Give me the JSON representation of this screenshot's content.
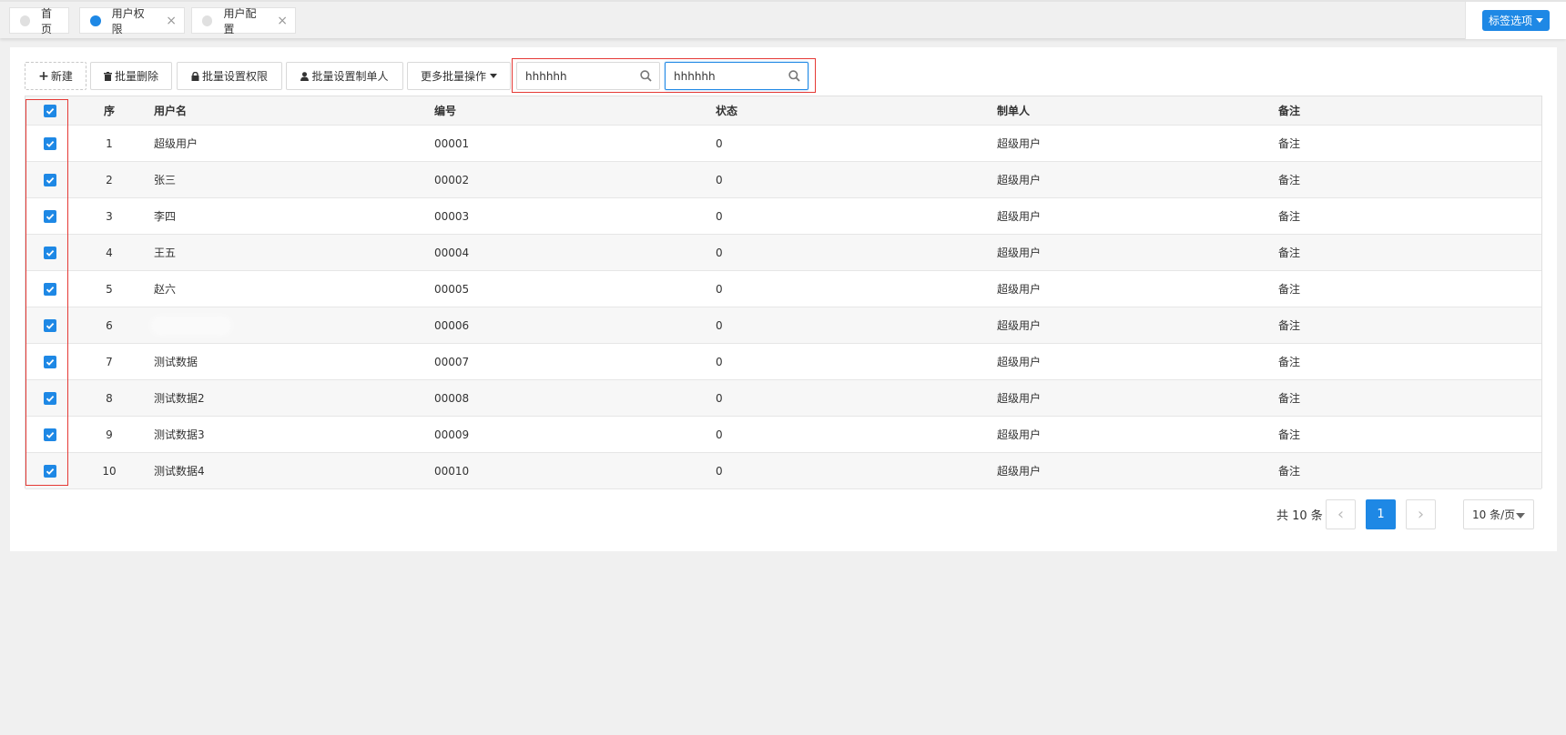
{
  "tabs": [
    {
      "label": "首页",
      "active": false,
      "closable": false
    },
    {
      "label": "用户权限",
      "active": true,
      "closable": true
    },
    {
      "label": "用户配置",
      "active": false,
      "closable": true
    }
  ],
  "tab_close_glyph": "×",
  "tag_options_label": "标签选项",
  "toolbar": {
    "new_label": "新建",
    "batch_delete_label": "批量删除",
    "batch_permission_label": "批量设置权限",
    "batch_creator_label": "批量设置制单人",
    "more_batch_label": "更多批量操作"
  },
  "search": {
    "first_value": "hhhhhh",
    "second_value": "hhhhhh"
  },
  "table": {
    "columns": [
      "序",
      "用户名",
      "编号",
      "状态",
      "制单人",
      "备注"
    ],
    "all_selected": true,
    "rows": [
      {
        "index": "1",
        "username": "超级用户",
        "code": "00001",
        "status": "0",
        "creator": "超级用户",
        "remark": "备注",
        "selected": true
      },
      {
        "index": "2",
        "username": "张三",
        "code": "00002",
        "status": "0",
        "creator": "超级用户",
        "remark": "备注",
        "selected": true
      },
      {
        "index": "3",
        "username": "李四",
        "code": "00003",
        "status": "0",
        "creator": "超级用户",
        "remark": "备注",
        "selected": true
      },
      {
        "index": "4",
        "username": "王五",
        "code": "00004",
        "status": "0",
        "creator": "超级用户",
        "remark": "备注",
        "selected": true
      },
      {
        "index": "5",
        "username": "赵六",
        "code": "00005",
        "status": "0",
        "creator": "超级用户",
        "remark": "备注",
        "selected": true
      },
      {
        "index": "6",
        "username": "",
        "code": "00006",
        "status": "0",
        "creator": "超级用户",
        "remark": "备注",
        "selected": true
      },
      {
        "index": "7",
        "username": "测试数据",
        "code": "00007",
        "status": "0",
        "creator": "超级用户",
        "remark": "备注",
        "selected": true
      },
      {
        "index": "8",
        "username": "测试数据2",
        "code": "00008",
        "status": "0",
        "creator": "超级用户",
        "remark": "备注",
        "selected": true
      },
      {
        "index": "9",
        "username": "测试数据3",
        "code": "00009",
        "status": "0",
        "creator": "超级用户",
        "remark": "备注",
        "selected": true
      },
      {
        "index": "10",
        "username": "测试数据4",
        "code": "00010",
        "status": "0",
        "creator": "超级用户",
        "remark": "备注",
        "selected": true
      }
    ]
  },
  "pagination": {
    "total_text": "共 10 条",
    "current_page": "1",
    "prev_glyph": "‹",
    "next_glyph": "›",
    "page_size_label": "10 条/页"
  },
  "colors": {
    "accent": "#1e88e5",
    "highlight_border": "#e53935"
  }
}
